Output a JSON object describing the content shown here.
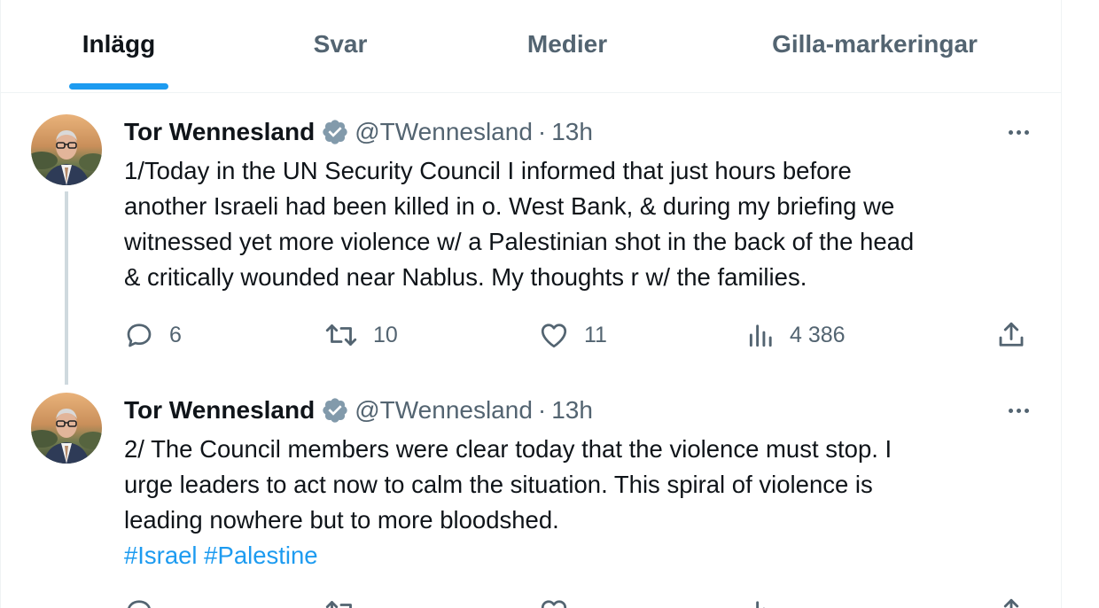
{
  "tabs": [
    {
      "label": "Inlägg",
      "active": true
    },
    {
      "label": "Svar",
      "active": false
    },
    {
      "label": "Medier",
      "active": false
    },
    {
      "label": "Gilla-markeringar",
      "active": false
    }
  ],
  "colors": {
    "accent": "#1d9bf0",
    "text_primary": "#0f1419",
    "text_secondary": "#536471",
    "verified_badge": "#829aab"
  },
  "tweets": [
    {
      "display_name": "Tor Wennesland",
      "handle": "@TWennesland",
      "separator": "·",
      "time": "13h",
      "verified_icon": "verified-badge-icon",
      "text_lines": [
        "1/Today in the UN Security Council I informed that just hours before",
        "another Israeli had been killed in o. West Bank, & during my briefing we",
        "witnessed yet more violence w/ a Palestinian shot in the back of the head",
        "& critically wounded near Nablus. My thoughts r w/ the families."
      ],
      "hashtags": "",
      "replies": "6",
      "reposts": "10",
      "likes": "11",
      "views": "4 386"
    },
    {
      "display_name": "Tor Wennesland",
      "handle": "@TWennesland",
      "separator": "·",
      "time": "13h",
      "verified_icon": "verified-badge-icon",
      "text_lines": [
        "2/ The Council members were clear today that the violence must stop. I",
        "urge leaders to act now to calm the situation. This spiral of violence is",
        "leading nowhere but to more bloodshed."
      ],
      "hashtags": "#Israel #Palestine",
      "replies": "",
      "reposts": "",
      "likes": "",
      "views": ""
    }
  ]
}
